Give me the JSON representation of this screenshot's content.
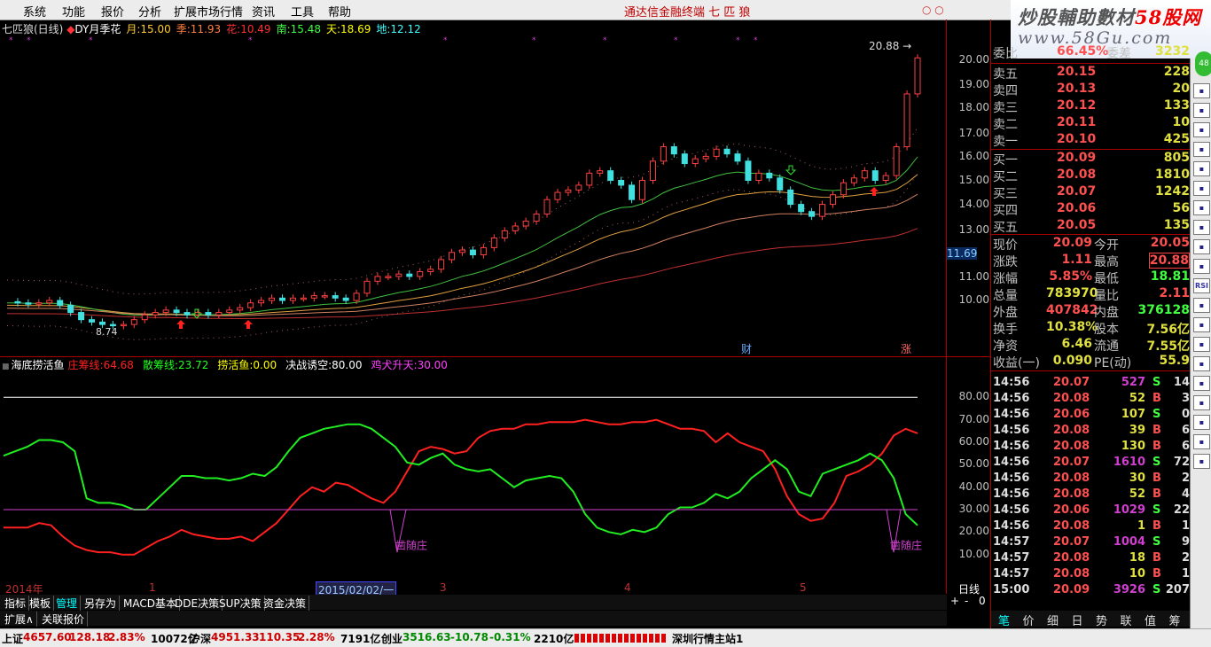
{
  "menu": [
    "系统",
    "功能",
    "报价",
    "分析",
    "扩展市场行情",
    "资讯",
    "工具",
    "帮助"
  ],
  "app_title": "通达信金融终端  七 匹 狼",
  "window_controls": "○ ○",
  "banner": {
    "title_a": "炒股輔助數材",
    "title_b": "58股网",
    "url": "www.58Gu.com"
  },
  "badge_text": "48",
  "kline_info": {
    "stock": "七匹狼(日线)",
    "indicator": "DY月季花",
    "items": [
      {
        "label": "月:",
        "value": "15.00",
        "color": "#ffcc33"
      },
      {
        "label": "季:",
        "value": "11.93",
        "color": "#ff8040"
      },
      {
        "label": "花:",
        "value": "10.49",
        "color": "#ff3030"
      },
      {
        "label": "南:",
        "value": "15.48",
        "color": "#40ff40"
      },
      {
        "label": "天:",
        "value": "18.69",
        "color": "#ffff00"
      },
      {
        "label": "地:",
        "value": "12.12",
        "color": "#40ffff"
      }
    ]
  },
  "price_axis": [
    "20.00",
    "19.00",
    "18.00",
    "17.00",
    "16.00",
    "15.00",
    "14.00",
    "13.00",
    "11.00",
    "10.00"
  ],
  "current_price_tag": "11.69",
  "high_label": "20.88",
  "low_label": "8.74",
  "event_markers": [
    "财",
    "涨"
  ],
  "indicator": {
    "name": "海底捞活鱼",
    "items": [
      {
        "label": "庄筹线:",
        "value": "64.68",
        "color": "#ff2020"
      },
      {
        "label": "散筹线:",
        "value": "23.72",
        "color": "#20ff20"
      },
      {
        "label": "捞活鱼:",
        "value": "0.00",
        "color": "#ffff00"
      },
      {
        "label": "决战诱空:",
        "value": "80.00",
        "color": "#ffffff"
      },
      {
        "label": "鸡犬升天:",
        "value": "30.00",
        "color": "#ff40ff"
      }
    ],
    "axis": [
      "80.00",
      "70.00",
      "60.00",
      "50.00",
      "40.00",
      "30.00",
      "20.00",
      "10.00"
    ],
    "annotation": "凿随庄"
  },
  "chart_data": {
    "type": "line",
    "title": "海底捞活鱼",
    "ylim": [
      0,
      90
    ],
    "series": [
      {
        "name": "庄筹线",
        "values": [
          22,
          22,
          22,
          24,
          23,
          18,
          14,
          12,
          11,
          11,
          10,
          10,
          13,
          16,
          18,
          21,
          19,
          18,
          17,
          17,
          18,
          16,
          20,
          24,
          30,
          36,
          40,
          38,
          42,
          41,
          38,
          35,
          33,
          38,
          47,
          56,
          58,
          57,
          55,
          56,
          62,
          65,
          66,
          66,
          68,
          68,
          69,
          69,
          69,
          70,
          69,
          68,
          68,
          69,
          69,
          70,
          68,
          66,
          66,
          65,
          60,
          64,
          60,
          58,
          56,
          48,
          36,
          28,
          25,
          26,
          33,
          45,
          47,
          50,
          55,
          63,
          66,
          64
        ]
      },
      {
        "name": "散筹线",
        "values": [
          54,
          56,
          58,
          61,
          61,
          60,
          56,
          35,
          33,
          33,
          32,
          30,
          30,
          35,
          40,
          45,
          45,
          44,
          44,
          43,
          44,
          46,
          45,
          49,
          56,
          62,
          64,
          66,
          67,
          68,
          68,
          66,
          62,
          58,
          51,
          50,
          53,
          55,
          50,
          48,
          47,
          48,
          44,
          40,
          43,
          44,
          45,
          44,
          38,
          28,
          22,
          20,
          19,
          21,
          20,
          22,
          28,
          31,
          31,
          33,
          37,
          35,
          38,
          44,
          48,
          52,
          48,
          38,
          36,
          46,
          48,
          50,
          52,
          55,
          52,
          44,
          28,
          23
        ]
      },
      {
        "name": "鸡犬升天",
        "values": [
          30,
          30,
          30,
          30,
          30,
          30,
          30,
          30,
          30,
          30,
          30,
          30,
          30,
          30,
          30,
          30,
          30,
          30,
          30,
          30,
          30,
          30,
          30,
          30,
          30,
          30,
          30,
          30,
          30,
          30,
          30,
          30,
          30,
          30,
          30,
          30,
          30,
          30,
          30,
          30,
          30,
          30,
          30,
          30,
          30,
          30,
          30,
          30,
          30,
          30,
          30,
          30,
          30,
          30,
          30,
          30,
          30,
          30,
          30,
          30,
          30,
          30,
          30,
          30,
          30,
          30,
          30,
          30,
          30,
          30,
          30,
          30,
          30,
          30,
          30,
          30,
          30,
          30
        ]
      },
      {
        "name": "决战诱空",
        "values": [
          80,
          80,
          80,
          80,
          80,
          80,
          80,
          80,
          80,
          80,
          80,
          80,
          80,
          80,
          80,
          80,
          80,
          80,
          80,
          80,
          80,
          80,
          80,
          80,
          80,
          80,
          80,
          80,
          80,
          80,
          80,
          80,
          80,
          80,
          80,
          80,
          80,
          80,
          80,
          80,
          80,
          80,
          80,
          80,
          80,
          80,
          80,
          80,
          80,
          80,
          80,
          80,
          80,
          80,
          80,
          80,
          80,
          80,
          80,
          80,
          80,
          80,
          80,
          80,
          80,
          80,
          80,
          80,
          80,
          80,
          80,
          80,
          80,
          80,
          80,
          80,
          80,
          80
        ]
      }
    ]
  },
  "date_axis": {
    "year": "2014年",
    "m1": "1",
    "selected": "2015/02/02/一",
    "m3": "3",
    "m4": "4",
    "m5": "5"
  },
  "period_label": "日线",
  "bottom_tabs1": [
    "指标",
    "模板",
    "管理",
    "另存为",
    "MACD基本",
    "DDE决策",
    "SUP决策",
    "资金决策"
  ],
  "bottom_tabs2": [
    "扩展∧",
    "关联报价"
  ],
  "zoom_controls": [
    "+",
    "-",
    "0"
  ],
  "quote": {
    "weibi": {
      "label": "委比",
      "value": "66.45%",
      "label2": "委差",
      "value2": "3232"
    },
    "asks": [
      {
        "label": "卖五",
        "price": "20.15",
        "vol": "228"
      },
      {
        "label": "卖四",
        "price": "20.13",
        "vol": "20"
      },
      {
        "label": "卖三",
        "price": "20.12",
        "vol": "133"
      },
      {
        "label": "卖二",
        "price": "20.11",
        "vol": "10"
      },
      {
        "label": "卖一",
        "price": "20.10",
        "vol": "425"
      }
    ],
    "bids": [
      {
        "label": "买一",
        "price": "20.09",
        "vol": "805"
      },
      {
        "label": "买二",
        "price": "20.08",
        "vol": "1810"
      },
      {
        "label": "买三",
        "price": "20.07",
        "vol": "1242"
      },
      {
        "label": "买四",
        "price": "20.06",
        "vol": "56"
      },
      {
        "label": "买五",
        "price": "20.05",
        "vol": "135"
      }
    ],
    "stats": [
      {
        "l1": "现价",
        "v1": "20.09",
        "l2": "今开",
        "v2": "20.05"
      },
      {
        "l1": "涨跌",
        "v1": "1.11",
        "l2": "最高",
        "v2": "20.88"
      },
      {
        "l1": "涨幅",
        "v1": "5.85%",
        "l2": "最低",
        "v2": "18.81"
      },
      {
        "l1": "总量",
        "v1": "783970",
        "l2": "量比",
        "v2": "2.11"
      },
      {
        "l1": "外盘",
        "v1": "407842",
        "l2": "内盘",
        "v2": "376128"
      },
      {
        "l1": "换手",
        "v1": "10.38%",
        "l2": "股本",
        "v2": "7.56亿"
      },
      {
        "l1": "净资",
        "v1": "6.46",
        "l2": "流通",
        "v2": "7.55亿"
      },
      {
        "l1": "收益(一)",
        "v1": "0.090",
        "l2": "PE(动)",
        "v2": "55.9"
      }
    ]
  },
  "ticks": [
    {
      "t": "14:56",
      "p": "20.07",
      "v": "527",
      "f": "S",
      "n": "14"
    },
    {
      "t": "14:56",
      "p": "20.08",
      "v": "52",
      "f": "B",
      "n": "3"
    },
    {
      "t": "14:56",
      "p": "20.06",
      "v": "107",
      "f": "S",
      "n": "0"
    },
    {
      "t": "14:56",
      "p": "20.08",
      "v": "39",
      "f": "B",
      "n": "6"
    },
    {
      "t": "14:56",
      "p": "20.08",
      "v": "130",
      "f": "B",
      "n": "6"
    },
    {
      "t": "14:56",
      "p": "20.07",
      "v": "1610",
      "f": "S",
      "n": "72"
    },
    {
      "t": "14:56",
      "p": "20.08",
      "v": "30",
      "f": "B",
      "n": "2"
    },
    {
      "t": "14:56",
      "p": "20.08",
      "v": "52",
      "f": "B",
      "n": "4"
    },
    {
      "t": "14:56",
      "p": "20.06",
      "v": "1029",
      "f": "S",
      "n": "22"
    },
    {
      "t": "14:56",
      "p": "20.08",
      "v": "1",
      "f": "B",
      "n": "1"
    },
    {
      "t": "14:57",
      "p": "20.07",
      "v": "1004",
      "f": "S",
      "n": "9"
    },
    {
      "t": "14:57",
      "p": "20.08",
      "v": "18",
      "f": "B",
      "n": "2"
    },
    {
      "t": "14:57",
      "p": "20.08",
      "v": "10",
      "f": "B",
      "n": "1"
    },
    {
      "t": "15:00",
      "p": "20.09",
      "v": "3926",
      "f": "S",
      "n": "207"
    }
  ],
  "bottom_tabs3": [
    "笔",
    "价",
    "细",
    "日",
    "势",
    "联",
    "值",
    "筹"
  ],
  "status": {
    "sh_label": "上证",
    "sh_val": "4657.60",
    "sh_chg": "128.18",
    "sh_pct": "2.83%",
    "sh_amt": "10072亿",
    "hs_label": "沪深",
    "hs_val": "4951.33",
    "hs_chg": "110.35",
    "hs_pct": "2.28%",
    "hs_amt": "7191亿",
    "cy_label": "创业",
    "cy_val": "3516.63",
    "cy_chg": "-10.78",
    "cy_pct": "-0.31%",
    "cy_amt": "2210亿",
    "conn": "深圳行情主站1"
  },
  "right_toolbar": [
    "48",
    "RSI"
  ]
}
